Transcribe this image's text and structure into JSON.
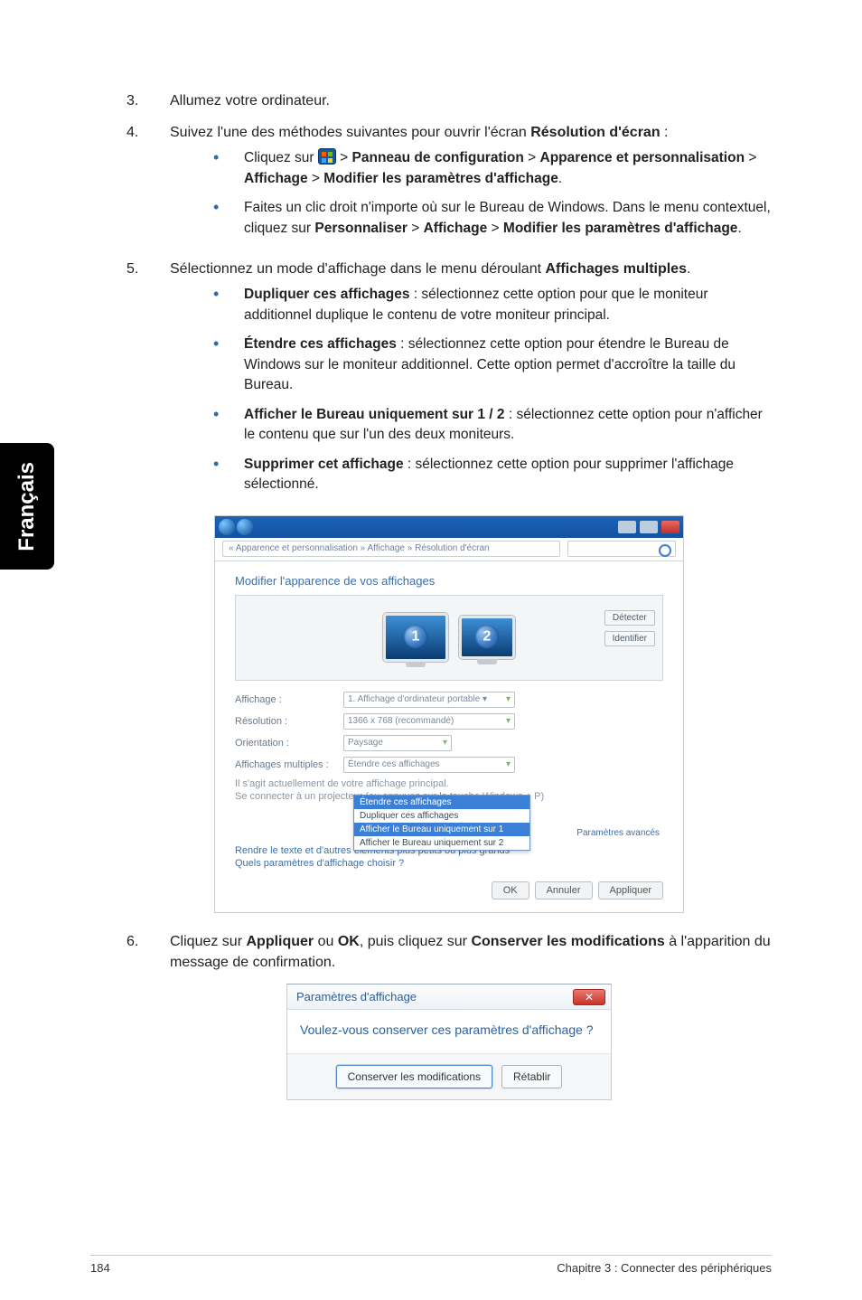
{
  "sideTab": "Français",
  "list": {
    "i3": {
      "num": "3.",
      "text": "Allumez votre ordinateur."
    },
    "i4": {
      "num": "4.",
      "intro_a": "Suivez l'une des méthodes suivantes pour ouvrir l'écran ",
      "intro_b": "Résolution d'écran",
      "intro_c": " :",
      "b1_a": "Cliquez sur ",
      "b1_b": " > ",
      "b1_c": "Panneau de configuration",
      "b1_d": " > ",
      "b1_e": "Apparence et personnalisation",
      "b1_f": " > ",
      "b1_g": "Affichage",
      "b1_h": " > ",
      "b1_i": "Modifier les paramètres d'affichage",
      "b1_j": ".",
      "b2_a": "Faites un clic droit n'importe où sur le Bureau de Windows. Dans le menu contextuel, cliquez sur ",
      "b2_b": "Personnaliser",
      "b2_c": " > ",
      "b2_d": "Affichage",
      "b2_e": " > ",
      "b2_f": "Modifier les paramètres d'affichage",
      "b2_g": "."
    },
    "i5": {
      "num": "5.",
      "intro_a": "Sélectionnez un mode d'affichage dans le menu déroulant ",
      "intro_b": "Affichages multiples",
      "intro_c": ".",
      "o1_a": "Dupliquer ces affichages",
      "o1_b": " : sélectionnez cette option pour que le moniteur additionnel duplique le contenu de votre moniteur principal.",
      "o2_a": "Étendre ces affichages",
      "o2_b": " : sélectionnez cette option pour étendre le Bureau de Windows sur le moniteur additionnel. Cette option permet d'accroître la taille du Bureau.",
      "o3_a": "Afficher le Bureau uniquement sur 1 / 2",
      "o3_b": " : sélectionnez cette option pour n'afficher le contenu que sur l'un des deux moniteurs.",
      "o4_a": "Supprimer cet affichage",
      "o4_b": " : sélectionnez cette option pour supprimer l'affichage sélectionné."
    },
    "i6": {
      "num": "6.",
      "a": "Cliquez sur ",
      "b": "Appliquer",
      "c": " ou ",
      "d": "OK",
      "e": ", puis cliquez sur ",
      "f": "Conserver les modifications",
      "g": " à l'apparition du message de confirmation."
    }
  },
  "fig1": {
    "crumb": "« Apparence et personnalisation » Affichage » Résolution d'écran",
    "heading": "Modifier l'apparence de vos affichages",
    "detect": "Détecter",
    "identify": "Identifier",
    "mon1": "1",
    "mon2": "2",
    "labels": {
      "affichage": "Affichage :",
      "resolution": "Résolution :",
      "orientation": "Orientation :",
      "multiples": "Affichages multiples :"
    },
    "values": {
      "affichage": "1. Affichage d'ordinateur portable ▾",
      "resolution": "1366 x 768 (recommandé)",
      "orientation": "Paysage"
    },
    "dropdown": {
      "opt1": "Étendre ces affichages",
      "opt2": "Dupliquer ces affichages",
      "opt3": "Afficher le Bureau uniquement sur 1",
      "opt4": "Afficher le Bureau uniquement sur 2"
    },
    "note1": "Il s'agit actuellement de votre affichage principal.",
    "note2": "Se connecter à un projecteur (ou appuyez sur la touche Windows + P)",
    "link1": "Rendre le texte et d'autres éléments plus petits ou plus grands",
    "link2": "Quels paramètres d'affichage choisir ?",
    "paramLink": "Paramètres avancés",
    "btns": {
      "ok": "OK",
      "cancel": "Annuler",
      "apply": "Appliquer"
    }
  },
  "fig2": {
    "title": "Paramètres d'affichage",
    "body": "Voulez-vous conserver ces paramètres d'affichage ?",
    "keep": "Conserver les modifications",
    "revert": "Rétablir",
    "closeGlyph": "✕"
  },
  "footer": {
    "page": "184",
    "chapter": "Chapitre 3 : Connecter des périphériques"
  }
}
